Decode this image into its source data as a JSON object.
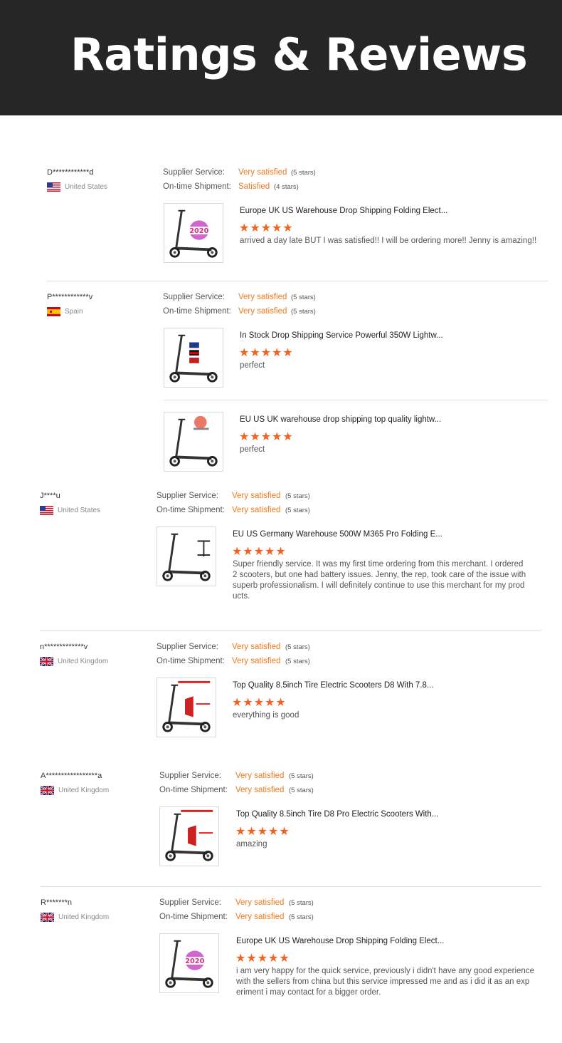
{
  "header": {
    "title": "Ratings & Reviews"
  },
  "labels": {
    "supplier": "Supplier Service:",
    "shipment": "On-time Shipment:"
  },
  "reviews": [
    {
      "user": "D************d",
      "country": "United States",
      "flag": "us-flag",
      "supplier": {
        "value": "Very satisfied",
        "count": "(5 stars)"
      },
      "shipment": {
        "value": "Satisfied",
        "count": "(4 stars)"
      },
      "products": [
        {
          "title": "Europe UK US Warehouse Drop Shipping Folding Elect...",
          "stars": "★★★★★",
          "rating": 5,
          "comment": "arrived a day late BUT I was satisfied!! I will be ordering more!! Jenny is amazing!!"
        }
      ]
    },
    {
      "user": "P************v",
      "country": "Spain",
      "flag": "spain-flag",
      "supplier": {
        "value": "Very satisfied",
        "count": "(5 stars)"
      },
      "shipment": {
        "value": "Very satisfied",
        "count": "(5 stars)"
      },
      "products": [
        {
          "title": "In Stock Drop Shipping Service Powerful 350W Lightw...",
          "stars": "★★★★★",
          "rating": 5,
          "comment": "perfect"
        },
        {
          "title": "EU US UK warehouse drop shipping top quality lightw...",
          "stars": "★★★★★",
          "rating": 5,
          "comment": "perfect"
        }
      ]
    },
    {
      "user": "J****u",
      "country": "United States",
      "flag": "us-flag",
      "supplier": {
        "value": "Very satisfied",
        "count": "(5 stars)"
      },
      "shipment": {
        "value": "Very satisfied",
        "count": "(5 stars)"
      },
      "products": [
        {
          "title": "EU US Germany Warehouse 500W M365 Pro Folding E...",
          "stars": "★★★★★",
          "rating": 5,
          "comment_lines": [
            "Super friendly service. It was my first time ordering from this merchant. I ordered",
            "2 scooters, but one had battery issues. Jenny, the rep, took care of the issue with",
            "superb professionalism. I will definitely continue to use this merchant for my prod",
            "ucts."
          ]
        }
      ]
    },
    {
      "user": "n*************v",
      "country": "United Kingdom",
      "flag": "uk-flag",
      "supplier": {
        "value": "Very satisfied",
        "count": "(5 stars)"
      },
      "shipment": {
        "value": "Very satisfied",
        "count": "(5 stars)"
      },
      "products": [
        {
          "title": "Top Quality 8.5inch Tire Electric Scooters D8 With 7.8...",
          "stars": "★★★★★",
          "rating": 5,
          "comment": "everything is good"
        }
      ]
    },
    {
      "user": "A*****************a",
      "country": "United Kingdom",
      "flag": "uk-flag",
      "supplier": {
        "value": "Very satisfied",
        "count": "(5 stars)"
      },
      "shipment": {
        "value": "Very satisfied",
        "count": "(5 stars)"
      },
      "products": [
        {
          "title": "Top Quality 8.5inch Tire D8 Pro Electric Scooters With...",
          "stars": "★★★★★",
          "rating": 5,
          "comment": "amazing"
        }
      ]
    },
    {
      "user": "R*******n",
      "country": "United Kingdom",
      "flag": "uk-flag",
      "supplier": {
        "value": "Very satisfied",
        "count": "(5 stars)"
      },
      "shipment": {
        "value": "Very satisfied",
        "count": "(5 stars)"
      },
      "products": [
        {
          "title": "Europe UK US Warehouse Drop Shipping Folding Elect...",
          "stars": "★★★★★",
          "rating": 5,
          "comment_lines": [
            "i am very happy for the quick service, previously i didn't have any good experience",
            "with the sellers from china but this service impressed me and as i did it as an exp",
            "eriment i may contact for a bigger order."
          ]
        }
      ]
    }
  ],
  "colors": {
    "accent": "#f07a1c",
    "star": "#f26322",
    "banner": "#262626"
  }
}
